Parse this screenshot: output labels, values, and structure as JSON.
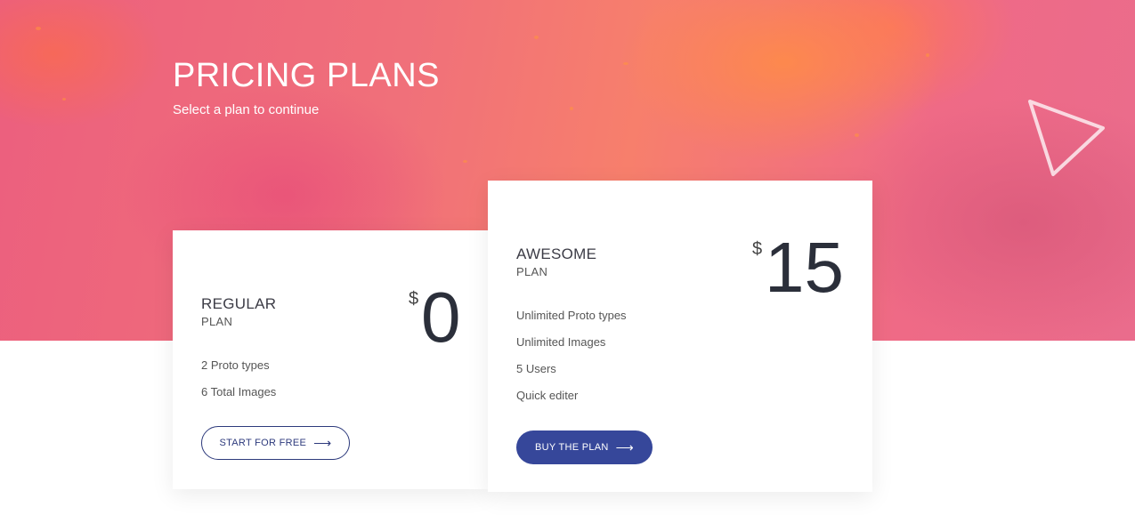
{
  "header": {
    "title": "PRICING PLANS",
    "subtitle": "Select a plan to continue",
    "decoration_icon": "triangle-outline-icon"
  },
  "plans": [
    {
      "name": "REGULAR",
      "sub": "PLAN",
      "currency": "$",
      "price": "0",
      "features": [
        "2 Proto types",
        "6 Total Images"
      ],
      "button_label": "START FOR FREE",
      "button_icon": "arrow-right-icon"
    },
    {
      "name": "AWESOME",
      "sub": "PLAN",
      "currency": "$",
      "price": "15",
      "features": [
        "Unlimited Proto types",
        "Unlimited Images",
        "5 Users",
        "Quick editer"
      ],
      "button_label": "BUY THE PLAN",
      "button_icon": "arrow-right-icon"
    }
  ],
  "colors": {
    "hero_gradient": [
      "#ec5f7e",
      "#f77f6c",
      "#ea6c8c"
    ],
    "button_primary": "#36479a",
    "button_outline": "#2d3a7c",
    "price_text": "#2b2f3a"
  }
}
